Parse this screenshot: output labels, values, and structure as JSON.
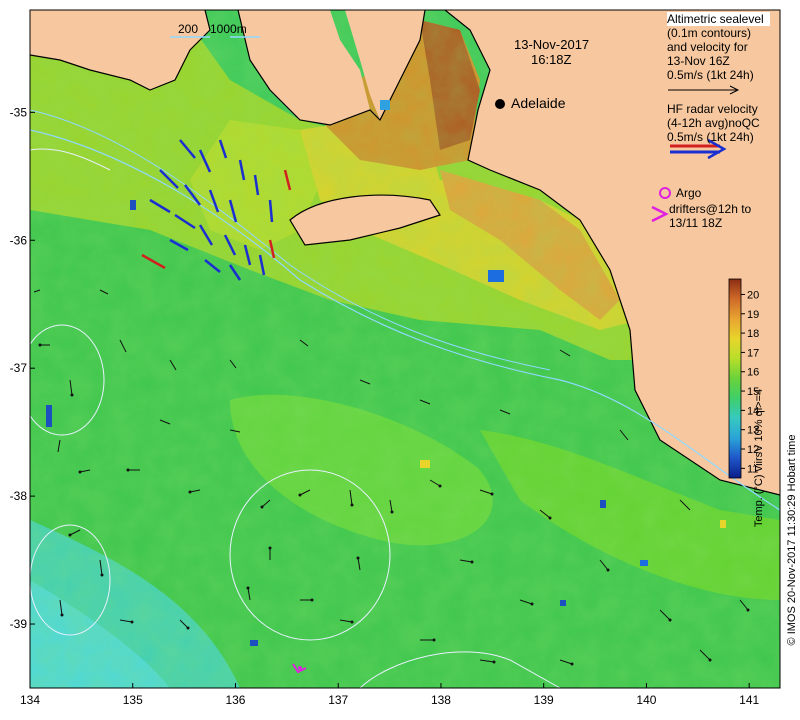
{
  "map": {
    "date": "13-Nov-2017",
    "time": "16:18Z",
    "city": "Adelaide",
    "scale_label_1": "200",
    "scale_label_2": "1000m",
    "lon_ticks": [
      "134",
      "135",
      "136",
      "137",
      "138",
      "139",
      "140",
      "141"
    ],
    "lat_ticks": [
      "-35",
      "-36",
      "-37",
      "-38",
      "-39"
    ],
    "lon_range": [
      134,
      141.3
    ],
    "lat_range": [
      -39.5,
      -34.2
    ]
  },
  "legend": {
    "altimetric_lines": [
      "Altimetric sealevel",
      "(0.1m contours)",
      "and velocity for",
      "13-Nov 16Z",
      "0.5m/s (1kt 24h)"
    ],
    "hf_lines": [
      "HF radar velocity",
      "(4-12h avg)noQC",
      "0.5m/s (1kt 24h)"
    ],
    "argo_label": "Argo",
    "drifter_lines": [
      "drifters@12h to",
      "13/11 18Z"
    ]
  },
  "colorbar": {
    "ticks": [
      "20",
      "19",
      "18",
      "17",
      "16",
      "15",
      "14",
      "13",
      "12",
      "11"
    ],
    "min": 10.5,
    "max": 20.8,
    "title": "Temp. (°C) viirsV 10% ql>=4",
    "colors": [
      "#0b1d8a",
      "#1f56c8",
      "#2aa3d8",
      "#36c9c0",
      "#3fcf6a",
      "#6ad23a",
      "#b8de2a",
      "#e8d52c",
      "#e9a431",
      "#cf6a28",
      "#8c2e14"
    ]
  },
  "credit": "© IMOS 20-Nov-2017 11:30:29 Hobart time"
}
